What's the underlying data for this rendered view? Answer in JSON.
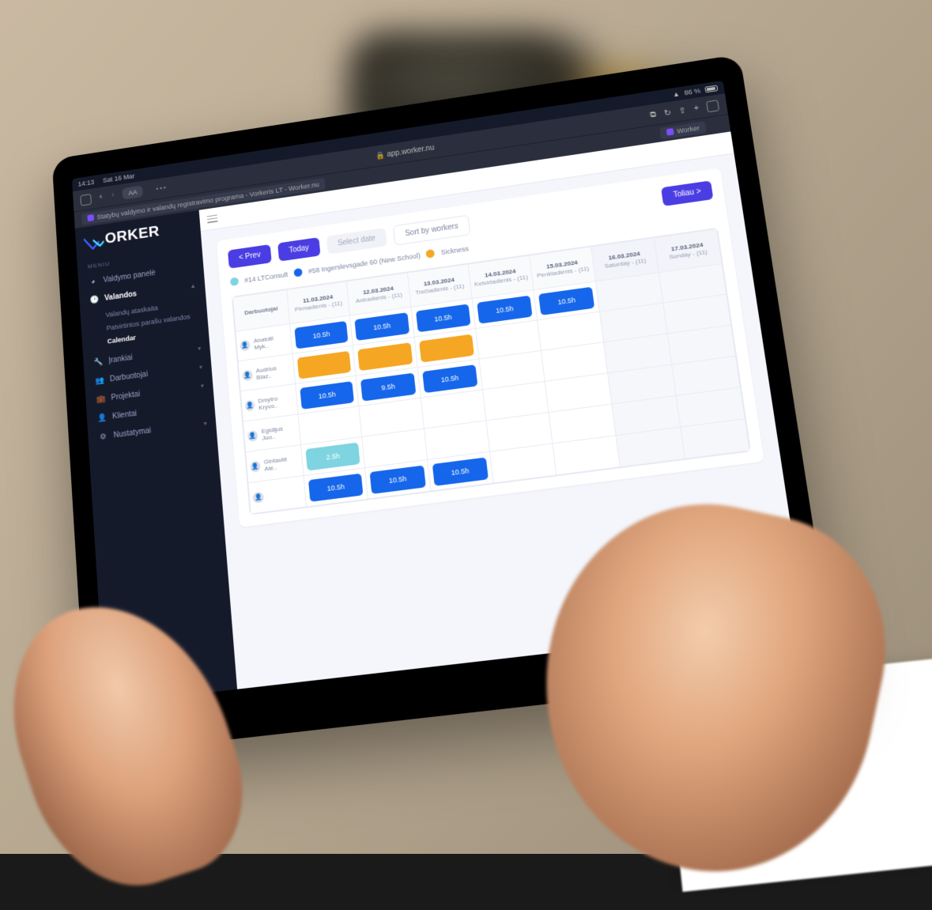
{
  "ios_status": {
    "time": "14:13",
    "date": "Sat 16 Mar",
    "battery": "86 %"
  },
  "safari": {
    "url": "app.worker.nu",
    "tab1": "Statybų valdymo ir valandų registravimo programa - Vorkeris LT - Worker.nu",
    "tab2": "Worker",
    "aa": "AA"
  },
  "brand": "ORKER",
  "menu_header": "MENIU",
  "nav": {
    "dashboard": "Valdymo panelė",
    "hours": "Valandos",
    "sub_report": "Valandų ataskaita",
    "sub_approved": "Patvirtintos parašu valandos",
    "sub_calendar": "Calendar",
    "tools": "Įrankiai",
    "employees": "Darbuotojai",
    "projects": "Projektai",
    "clients": "Klientai",
    "settings": "Nustatymai"
  },
  "controls": {
    "prev": "< Prev",
    "today": "Today",
    "select_date": "Select date",
    "sort": "Sort by workers",
    "next": "Toliau >"
  },
  "legend": {
    "item1": {
      "label": "#14 LTConsult",
      "color": "#7ed4e0"
    },
    "item2": {
      "label": "#58 Ingerslevsgade 60 (New School)",
      "color": "#1566ea"
    },
    "item3": {
      "label": "Sickness",
      "color": "#f5a623"
    }
  },
  "colHeader": "Darbuotojai",
  "days": [
    {
      "date": "11.03.2024",
      "day": "Pirmadienis - (11)",
      "weekend": false
    },
    {
      "date": "12.03.2024",
      "day": "Antradienis - (11)",
      "weekend": false
    },
    {
      "date": "13.03.2024",
      "day": "Trečiadienis - (11)",
      "weekend": false
    },
    {
      "date": "14.03.2024",
      "day": "Ketvirtadienis - (11)",
      "weekend": false
    },
    {
      "date": "15.03.2024",
      "day": "Penktadienis - (11)",
      "weekend": false
    },
    {
      "date": "16.03.2024",
      "day": "Saturday - (11)",
      "weekend": true
    },
    {
      "date": "17.03.2024",
      "day": "Sunday - (11)",
      "weekend": true
    }
  ],
  "rows": [
    {
      "name": "Anatolii Myk..",
      "cells": [
        {
          "text": "10.5h",
          "cls": "blue"
        },
        {
          "text": "10.5h",
          "cls": "blue"
        },
        {
          "text": "10.5h",
          "cls": "blue"
        },
        {
          "text": "10.5h",
          "cls": "blue"
        },
        {
          "text": "10.5h",
          "cls": "blue"
        },
        {
          "text": "",
          "cls": ""
        },
        {
          "text": "",
          "cls": ""
        }
      ]
    },
    {
      "name": "Audrius Blaz..",
      "cells": [
        {
          "text": "",
          "cls": "orange"
        },
        {
          "text": "",
          "cls": "orange"
        },
        {
          "text": "",
          "cls": "orange"
        },
        {
          "text": "",
          "cls": ""
        },
        {
          "text": "",
          "cls": ""
        },
        {
          "text": "",
          "cls": ""
        },
        {
          "text": "",
          "cls": ""
        }
      ]
    },
    {
      "name": "Dmytro Kryvo..",
      "cells": [
        {
          "text": "10.5h",
          "cls": "blue"
        },
        {
          "text": "9.5h",
          "cls": "blue"
        },
        {
          "text": "10.5h",
          "cls": "blue"
        },
        {
          "text": "",
          "cls": ""
        },
        {
          "text": "",
          "cls": ""
        },
        {
          "text": "",
          "cls": ""
        },
        {
          "text": "",
          "cls": ""
        }
      ]
    },
    {
      "name": "Egidijus Juo..",
      "cells": [
        {
          "text": "",
          "cls": ""
        },
        {
          "text": "",
          "cls": ""
        },
        {
          "text": "",
          "cls": ""
        },
        {
          "text": "",
          "cls": ""
        },
        {
          "text": "",
          "cls": ""
        },
        {
          "text": "",
          "cls": ""
        },
        {
          "text": "",
          "cls": ""
        }
      ]
    },
    {
      "name": "Gintautė Ale..",
      "cells": [
        {
          "text": "2.5h",
          "cls": "teal"
        },
        {
          "text": "",
          "cls": ""
        },
        {
          "text": "",
          "cls": ""
        },
        {
          "text": "",
          "cls": ""
        },
        {
          "text": "",
          "cls": ""
        },
        {
          "text": "",
          "cls": ""
        },
        {
          "text": "",
          "cls": ""
        }
      ]
    },
    {
      "name": "",
      "cells": [
        {
          "text": "10.5h",
          "cls": "blue"
        },
        {
          "text": "10.5h",
          "cls": "blue"
        },
        {
          "text": "10.5h",
          "cls": "blue"
        },
        {
          "text": "",
          "cls": ""
        },
        {
          "text": "",
          "cls": ""
        },
        {
          "text": "",
          "cls": ""
        },
        {
          "text": "",
          "cls": ""
        }
      ]
    }
  ]
}
